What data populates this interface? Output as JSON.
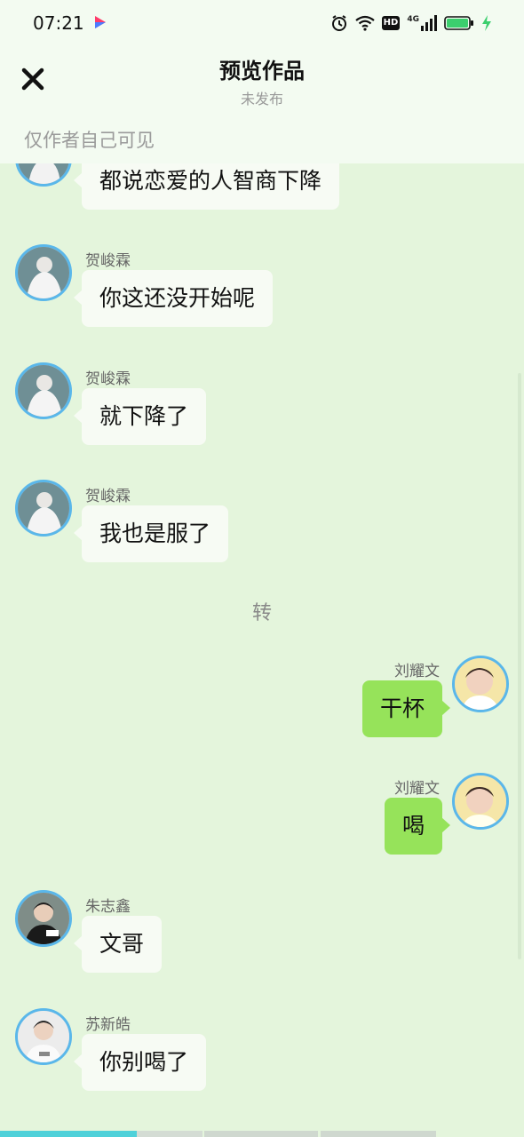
{
  "status_bar": {
    "time": "07:21",
    "icons": [
      "app-icon",
      "alarm-icon",
      "wifi-icon",
      "hd-icon",
      "signal-4g-icon",
      "battery-icon",
      "charging-icon"
    ],
    "hd_label": "HD",
    "network_label": "4G"
  },
  "header": {
    "title": "预览作品",
    "subtitle": "未发布",
    "visibility": "仅作者自己可见",
    "close_icon": "close-icon"
  },
  "messages": [
    {
      "side": "left",
      "name": "",
      "text": "都说恋爱的人智商下降"
    },
    {
      "side": "left",
      "name": "贺峻霖",
      "text": "你这还没开始呢"
    },
    {
      "side": "left",
      "name": "贺峻霖",
      "text": "就下降了"
    },
    {
      "side": "left",
      "name": "贺峻霖",
      "text": "我也是服了"
    },
    {
      "side": "center",
      "text": "转"
    },
    {
      "side": "right",
      "name": "刘耀文",
      "text": "干杯"
    },
    {
      "side": "right",
      "name": "刘耀文",
      "text": "喝"
    },
    {
      "side": "left",
      "name": "朱志鑫",
      "text": "文哥"
    },
    {
      "side": "left",
      "name": "苏新皓",
      "text": "你别喝了"
    }
  ],
  "colors": {
    "background": "#e4f5dc",
    "header": "#f3fbf1",
    "bubble_left": "#f7fbf4",
    "bubble_right": "#96e35a",
    "avatar_ring": "#5ab7ea",
    "progress_active": "#4fd1d9"
  },
  "progress": {
    "segments": 4,
    "active_fraction_of_first": 0.6
  }
}
